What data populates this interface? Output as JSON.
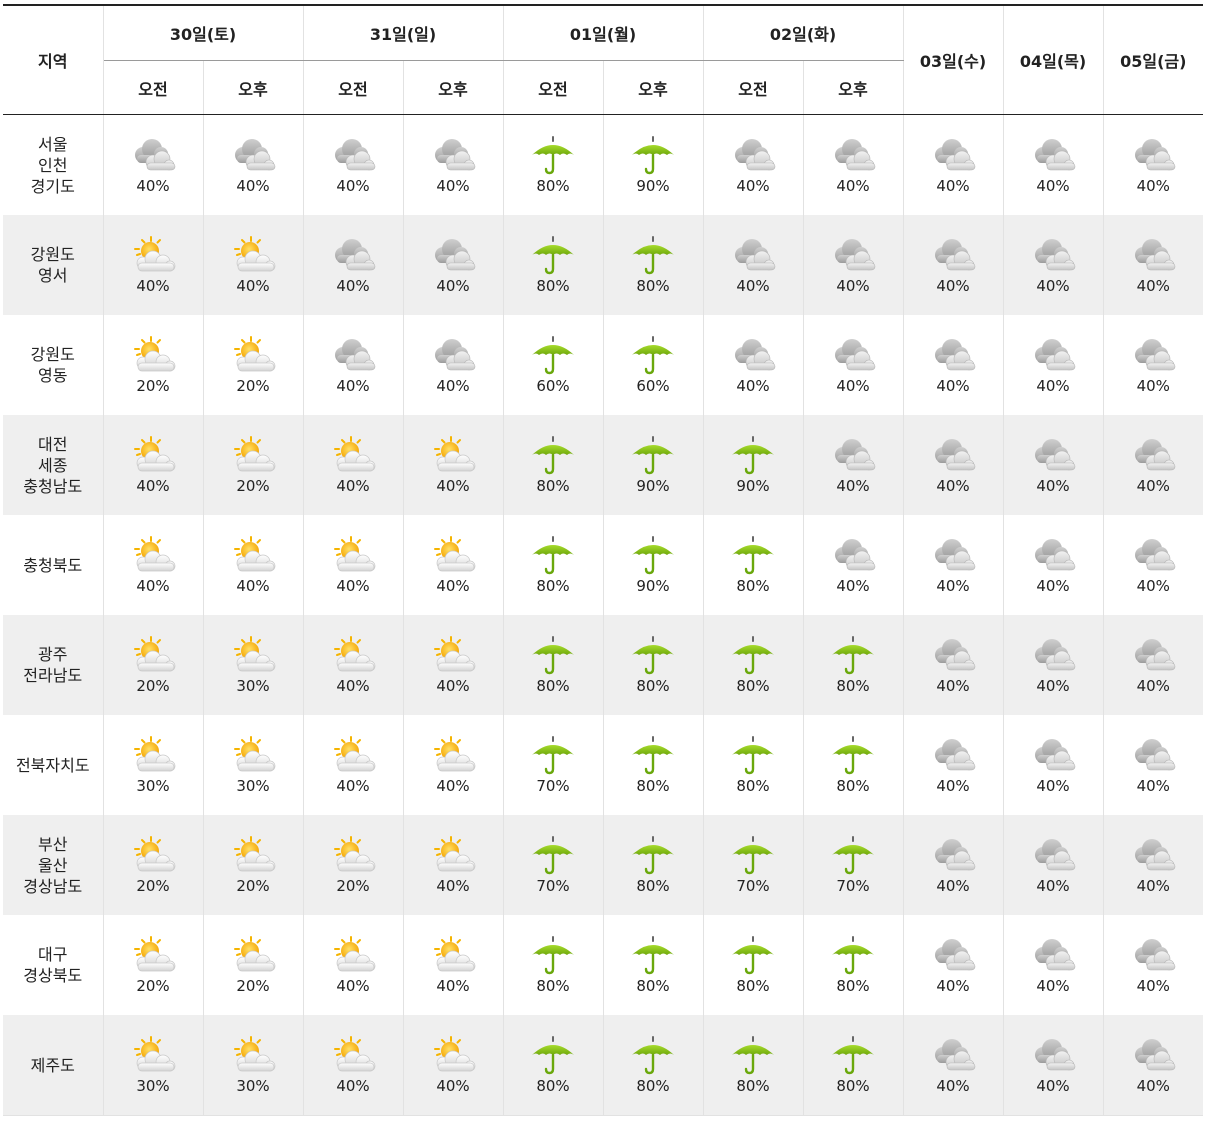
{
  "header": {
    "region_label": "지역",
    "days_split": [
      {
        "label": "30일(토)",
        "am": "오전",
        "pm": "오후"
      },
      {
        "label": "31일(일)",
        "am": "오전",
        "pm": "오후"
      },
      {
        "label": "01일(월)",
        "am": "오전",
        "pm": "오후"
      },
      {
        "label": "02일(화)",
        "am": "오전",
        "pm": "오후"
      }
    ],
    "days_single": [
      "03일(수)",
      "04일(목)",
      "05일(금)"
    ]
  },
  "icons": {
    "cloudy": "cloudy-icon",
    "partly_cloudy": "partly-cloudy-icon",
    "rain": "umbrella-rain-icon"
  },
  "colors": {
    "umbrella_green": "#8cc71c",
    "sun_yellow": "#ffc21c",
    "cloud_gray": "#a9a9a9",
    "row_shade": "#efefef"
  },
  "rows": [
    {
      "region": [
        "서울",
        "인천",
        "경기도"
      ],
      "cells": [
        {
          "icon": "cloudy",
          "pct": "40%"
        },
        {
          "icon": "cloudy",
          "pct": "40%"
        },
        {
          "icon": "cloudy",
          "pct": "40%"
        },
        {
          "icon": "cloudy",
          "pct": "40%"
        },
        {
          "icon": "rain",
          "pct": "80%"
        },
        {
          "icon": "rain",
          "pct": "90%"
        },
        {
          "icon": "cloudy",
          "pct": "40%"
        },
        {
          "icon": "cloudy",
          "pct": "40%"
        },
        {
          "icon": "cloudy",
          "pct": "40%"
        },
        {
          "icon": "cloudy",
          "pct": "40%"
        },
        {
          "icon": "cloudy",
          "pct": "40%"
        }
      ]
    },
    {
      "region": [
        "강원도",
        "영서"
      ],
      "cells": [
        {
          "icon": "partly_cloudy",
          "pct": "40%"
        },
        {
          "icon": "partly_cloudy",
          "pct": "40%"
        },
        {
          "icon": "cloudy",
          "pct": "40%"
        },
        {
          "icon": "cloudy",
          "pct": "40%"
        },
        {
          "icon": "rain",
          "pct": "80%"
        },
        {
          "icon": "rain",
          "pct": "80%"
        },
        {
          "icon": "cloudy",
          "pct": "40%"
        },
        {
          "icon": "cloudy",
          "pct": "40%"
        },
        {
          "icon": "cloudy",
          "pct": "40%"
        },
        {
          "icon": "cloudy",
          "pct": "40%"
        },
        {
          "icon": "cloudy",
          "pct": "40%"
        }
      ]
    },
    {
      "region": [
        "강원도",
        "영동"
      ],
      "cells": [
        {
          "icon": "partly_cloudy",
          "pct": "20%"
        },
        {
          "icon": "partly_cloudy",
          "pct": "20%"
        },
        {
          "icon": "cloudy",
          "pct": "40%"
        },
        {
          "icon": "cloudy",
          "pct": "40%"
        },
        {
          "icon": "rain",
          "pct": "60%"
        },
        {
          "icon": "rain",
          "pct": "60%"
        },
        {
          "icon": "cloudy",
          "pct": "40%"
        },
        {
          "icon": "cloudy",
          "pct": "40%"
        },
        {
          "icon": "cloudy",
          "pct": "40%"
        },
        {
          "icon": "cloudy",
          "pct": "40%"
        },
        {
          "icon": "cloudy",
          "pct": "40%"
        }
      ]
    },
    {
      "region": [
        "대전",
        "세종",
        "충청남도"
      ],
      "cells": [
        {
          "icon": "partly_cloudy",
          "pct": "40%"
        },
        {
          "icon": "partly_cloudy",
          "pct": "20%"
        },
        {
          "icon": "partly_cloudy",
          "pct": "40%"
        },
        {
          "icon": "partly_cloudy",
          "pct": "40%"
        },
        {
          "icon": "rain",
          "pct": "80%"
        },
        {
          "icon": "rain",
          "pct": "90%"
        },
        {
          "icon": "rain",
          "pct": "90%"
        },
        {
          "icon": "cloudy",
          "pct": "40%"
        },
        {
          "icon": "cloudy",
          "pct": "40%"
        },
        {
          "icon": "cloudy",
          "pct": "40%"
        },
        {
          "icon": "cloudy",
          "pct": "40%"
        }
      ]
    },
    {
      "region": [
        "충청북도"
      ],
      "cells": [
        {
          "icon": "partly_cloudy",
          "pct": "40%"
        },
        {
          "icon": "partly_cloudy",
          "pct": "40%"
        },
        {
          "icon": "partly_cloudy",
          "pct": "40%"
        },
        {
          "icon": "partly_cloudy",
          "pct": "40%"
        },
        {
          "icon": "rain",
          "pct": "80%"
        },
        {
          "icon": "rain",
          "pct": "90%"
        },
        {
          "icon": "rain",
          "pct": "80%"
        },
        {
          "icon": "cloudy",
          "pct": "40%"
        },
        {
          "icon": "cloudy",
          "pct": "40%"
        },
        {
          "icon": "cloudy",
          "pct": "40%"
        },
        {
          "icon": "cloudy",
          "pct": "40%"
        }
      ]
    },
    {
      "region": [
        "광주",
        "전라남도"
      ],
      "cells": [
        {
          "icon": "partly_cloudy",
          "pct": "20%"
        },
        {
          "icon": "partly_cloudy",
          "pct": "30%"
        },
        {
          "icon": "partly_cloudy",
          "pct": "40%"
        },
        {
          "icon": "partly_cloudy",
          "pct": "40%"
        },
        {
          "icon": "rain",
          "pct": "80%"
        },
        {
          "icon": "rain",
          "pct": "80%"
        },
        {
          "icon": "rain",
          "pct": "80%"
        },
        {
          "icon": "rain",
          "pct": "80%"
        },
        {
          "icon": "cloudy",
          "pct": "40%"
        },
        {
          "icon": "cloudy",
          "pct": "40%"
        },
        {
          "icon": "cloudy",
          "pct": "40%"
        }
      ]
    },
    {
      "region": [
        "전북자치도"
      ],
      "cells": [
        {
          "icon": "partly_cloudy",
          "pct": "30%"
        },
        {
          "icon": "partly_cloudy",
          "pct": "30%"
        },
        {
          "icon": "partly_cloudy",
          "pct": "40%"
        },
        {
          "icon": "partly_cloudy",
          "pct": "40%"
        },
        {
          "icon": "rain",
          "pct": "70%"
        },
        {
          "icon": "rain",
          "pct": "80%"
        },
        {
          "icon": "rain",
          "pct": "80%"
        },
        {
          "icon": "rain",
          "pct": "80%"
        },
        {
          "icon": "cloudy",
          "pct": "40%"
        },
        {
          "icon": "cloudy",
          "pct": "40%"
        },
        {
          "icon": "cloudy",
          "pct": "40%"
        }
      ]
    },
    {
      "region": [
        "부산",
        "울산",
        "경상남도"
      ],
      "cells": [
        {
          "icon": "partly_cloudy",
          "pct": "20%"
        },
        {
          "icon": "partly_cloudy",
          "pct": "20%"
        },
        {
          "icon": "partly_cloudy",
          "pct": "20%"
        },
        {
          "icon": "partly_cloudy",
          "pct": "40%"
        },
        {
          "icon": "rain",
          "pct": "70%"
        },
        {
          "icon": "rain",
          "pct": "80%"
        },
        {
          "icon": "rain",
          "pct": "70%"
        },
        {
          "icon": "rain",
          "pct": "70%"
        },
        {
          "icon": "cloudy",
          "pct": "40%"
        },
        {
          "icon": "cloudy",
          "pct": "40%"
        },
        {
          "icon": "cloudy",
          "pct": "40%"
        }
      ]
    },
    {
      "region": [
        "대구",
        "경상북도"
      ],
      "cells": [
        {
          "icon": "partly_cloudy",
          "pct": "20%"
        },
        {
          "icon": "partly_cloudy",
          "pct": "20%"
        },
        {
          "icon": "partly_cloudy",
          "pct": "40%"
        },
        {
          "icon": "partly_cloudy",
          "pct": "40%"
        },
        {
          "icon": "rain",
          "pct": "80%"
        },
        {
          "icon": "rain",
          "pct": "80%"
        },
        {
          "icon": "rain",
          "pct": "80%"
        },
        {
          "icon": "rain",
          "pct": "80%"
        },
        {
          "icon": "cloudy",
          "pct": "40%"
        },
        {
          "icon": "cloudy",
          "pct": "40%"
        },
        {
          "icon": "cloudy",
          "pct": "40%"
        }
      ]
    },
    {
      "region": [
        "제주도"
      ],
      "cells": [
        {
          "icon": "partly_cloudy",
          "pct": "30%"
        },
        {
          "icon": "partly_cloudy",
          "pct": "30%"
        },
        {
          "icon": "partly_cloudy",
          "pct": "40%"
        },
        {
          "icon": "partly_cloudy",
          "pct": "40%"
        },
        {
          "icon": "rain",
          "pct": "80%"
        },
        {
          "icon": "rain",
          "pct": "80%"
        },
        {
          "icon": "rain",
          "pct": "80%"
        },
        {
          "icon": "rain",
          "pct": "80%"
        },
        {
          "icon": "cloudy",
          "pct": "40%"
        },
        {
          "icon": "cloudy",
          "pct": "40%"
        },
        {
          "icon": "cloudy",
          "pct": "40%"
        }
      ]
    }
  ]
}
